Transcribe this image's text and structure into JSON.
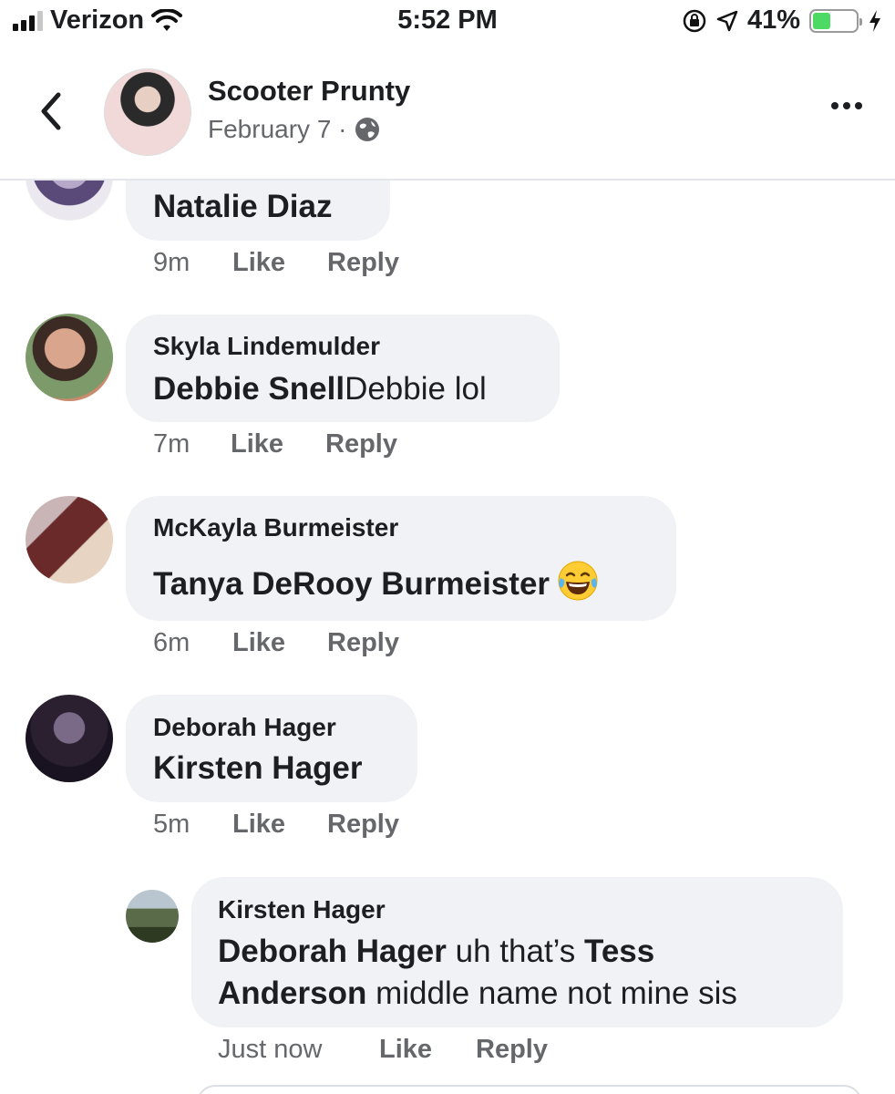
{
  "status_bar": {
    "carrier": "Verizon",
    "time": "5:52 PM",
    "battery": "41%",
    "battery_level": 0.41,
    "icons": [
      "signal-icon",
      "wifi-icon",
      "rotation-lock-icon",
      "location-icon",
      "battery-icon",
      "charging-icon"
    ]
  },
  "header": {
    "name": "Scooter Prunty",
    "date": "February 7 ·",
    "icons": [
      "back-chevron-icon",
      "globe-icon",
      "more-dots-icon"
    ]
  },
  "comments": [
    {
      "name": "",
      "parts": [
        {
          "text": "Natalie Diaz",
          "mention": true
        }
      ],
      "time": "9m",
      "like": "Like",
      "reply": "Reply"
    },
    {
      "name": "Skyla Lindemulder",
      "parts": [
        {
          "text": "Debbie Snell",
          "mention": true
        },
        {
          "text": "Debbie lol",
          "mention": false
        }
      ],
      "time": "7m",
      "like": "Like",
      "reply": "Reply"
    },
    {
      "name": "McKayla Burmeister",
      "parts": [
        {
          "text": "Tanya DeRooy Burmeister",
          "mention": true
        }
      ],
      "emoji": "tears-of-joy-emoji",
      "time": "6m",
      "like": "Like",
      "reply": "Reply"
    },
    {
      "name": "Deborah Hager",
      "parts": [
        {
          "text": "Kirsten Hager",
          "mention": true
        }
      ],
      "time": "5m",
      "like": "Like",
      "reply": "Reply"
    },
    {
      "name": "Kirsten Hager",
      "line1": [
        {
          "text": "Deborah Hager",
          "mention": true
        },
        {
          "text": " uh that’s ",
          "mention": false
        },
        {
          "text": "Tess",
          "mention": true
        }
      ],
      "line2": [
        {
          "text": "Anderson",
          "mention": true
        },
        {
          "text": " middle name not mine sis",
          "mention": false
        }
      ],
      "time": "Just now",
      "like": "Like",
      "reply": "Reply"
    }
  ]
}
